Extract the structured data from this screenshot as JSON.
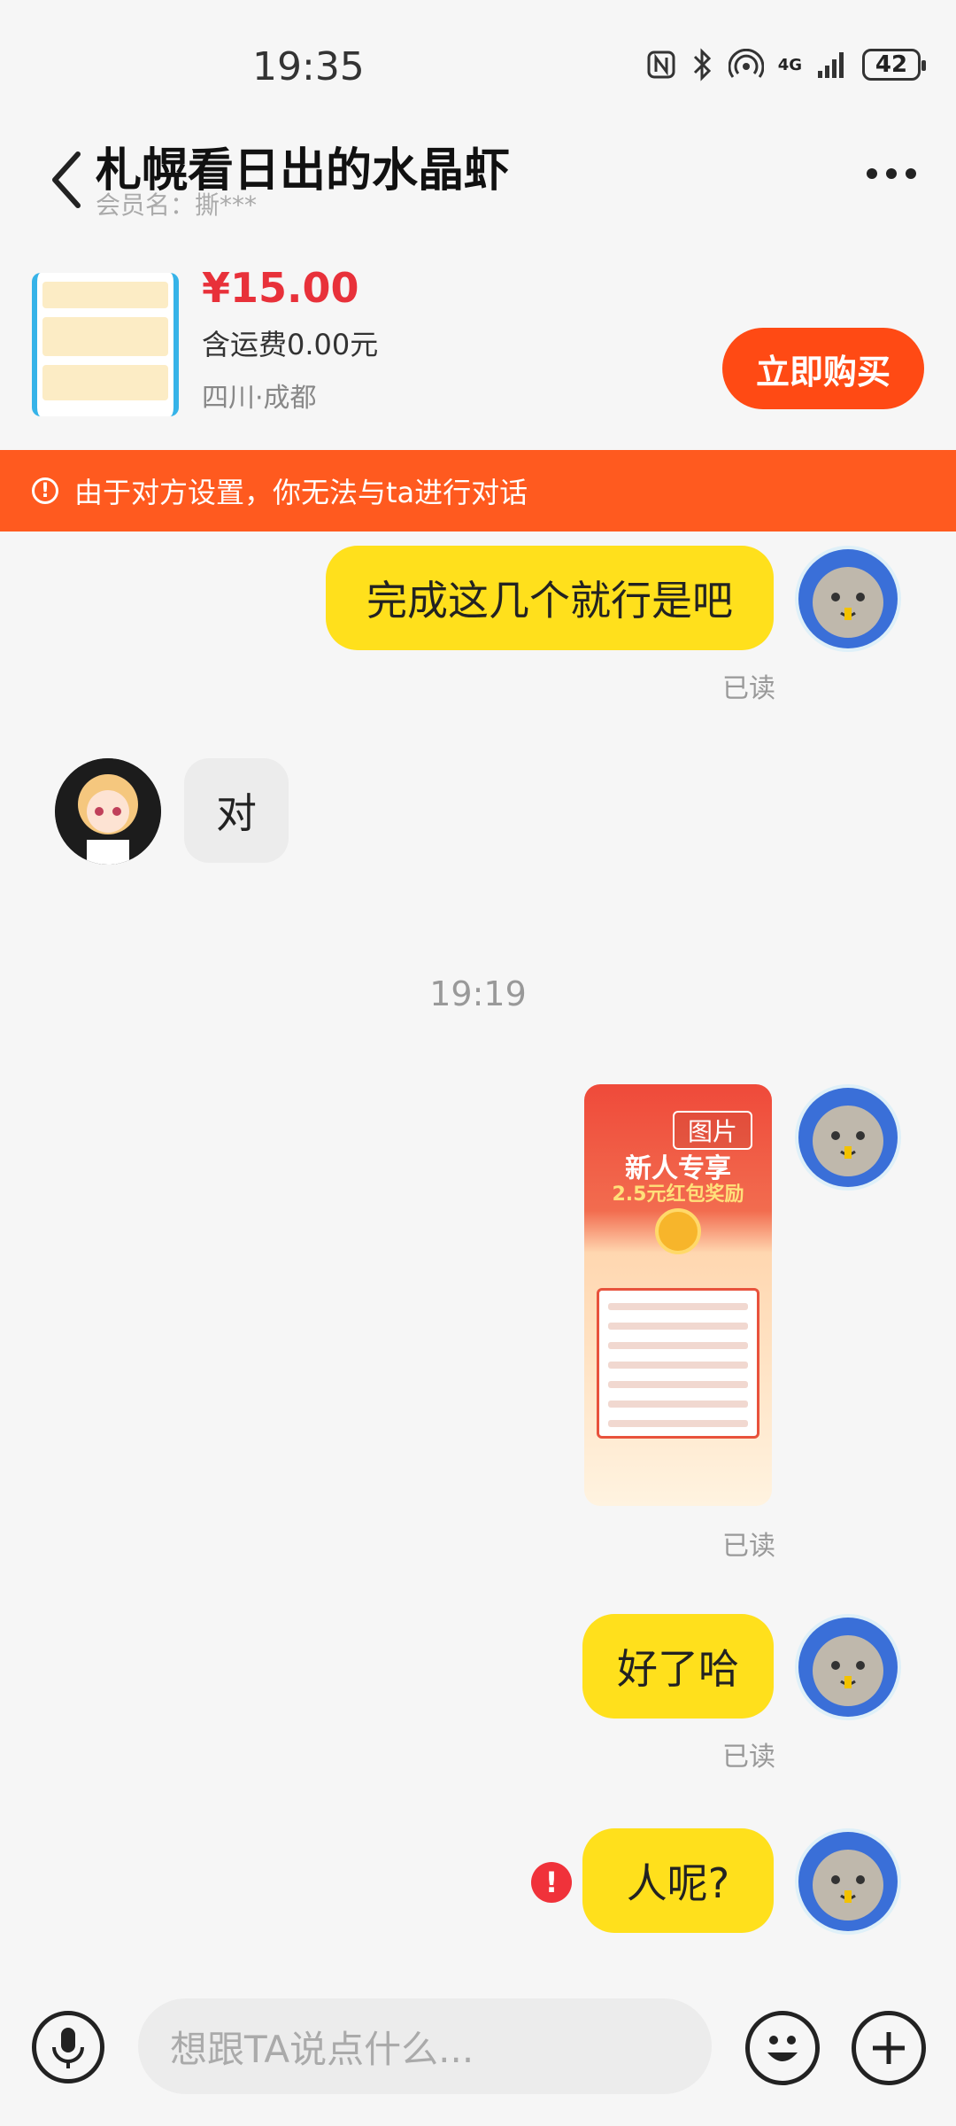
{
  "status_bar": {
    "time": "19:35",
    "battery": "42",
    "network": "4G"
  },
  "header": {
    "title": "札幌看日出的水晶虾",
    "member_label": "会员名：撕***"
  },
  "product": {
    "price": "¥15.00",
    "shipping": "含运费0.00元",
    "location": "四川·成都",
    "buy_label": "立即购买"
  },
  "banner": {
    "text": "由于对方设置，你无法与ta进行对话"
  },
  "messages": {
    "m1": {
      "text": "完成这几个就行是吧",
      "status": "已读"
    },
    "m2": {
      "text": "对"
    },
    "timestamp": "19:19",
    "m3": {
      "image_badge": "图片",
      "image_title": "新人专享",
      "image_subtitle": "2.5元红包奖励",
      "status": "已读"
    },
    "m4": {
      "text": "好了哈",
      "status": "已读"
    },
    "m5": {
      "text": "人呢?"
    }
  },
  "input": {
    "placeholder": "想跟TA说点什么..."
  },
  "colors": {
    "accent": "#ff4a14",
    "bubble_self": "#ffe01c",
    "price": "#e8313a",
    "banner": "#ff5a1f"
  }
}
